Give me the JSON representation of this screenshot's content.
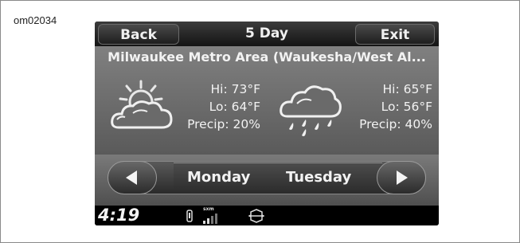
{
  "figure_label": "om02034",
  "header": {
    "back_label": "Back",
    "title": "5 Day",
    "exit_label": "Exit"
  },
  "location": "Milwaukee Metro Area (Waukesha/West Al...",
  "forecast": [
    {
      "day": "Monday",
      "icon": "partly-cloudy-icon",
      "hi": "Hi: 73°F",
      "lo": "Lo: 64°F",
      "precip": "Precip: 20%"
    },
    {
      "day": "Tuesday",
      "icon": "rain-icon",
      "hi": "Hi: 65°F",
      "lo": "Lo: 56°F",
      "precip": "Precip: 40%"
    }
  ],
  "nav": {
    "prev_icon": "left-arrow-icon",
    "next_icon": "right-arrow-icon"
  },
  "status": {
    "clock": "4:19",
    "sxm_text": "sxm",
    "icons": [
      "phone-icon",
      "sxm-signal-icon",
      "harley-logo-icon"
    ]
  },
  "colors": {
    "screen_bg": "#5c5c5c",
    "bar_bg": "#1e1e1e",
    "text": "#f2f2f2"
  }
}
